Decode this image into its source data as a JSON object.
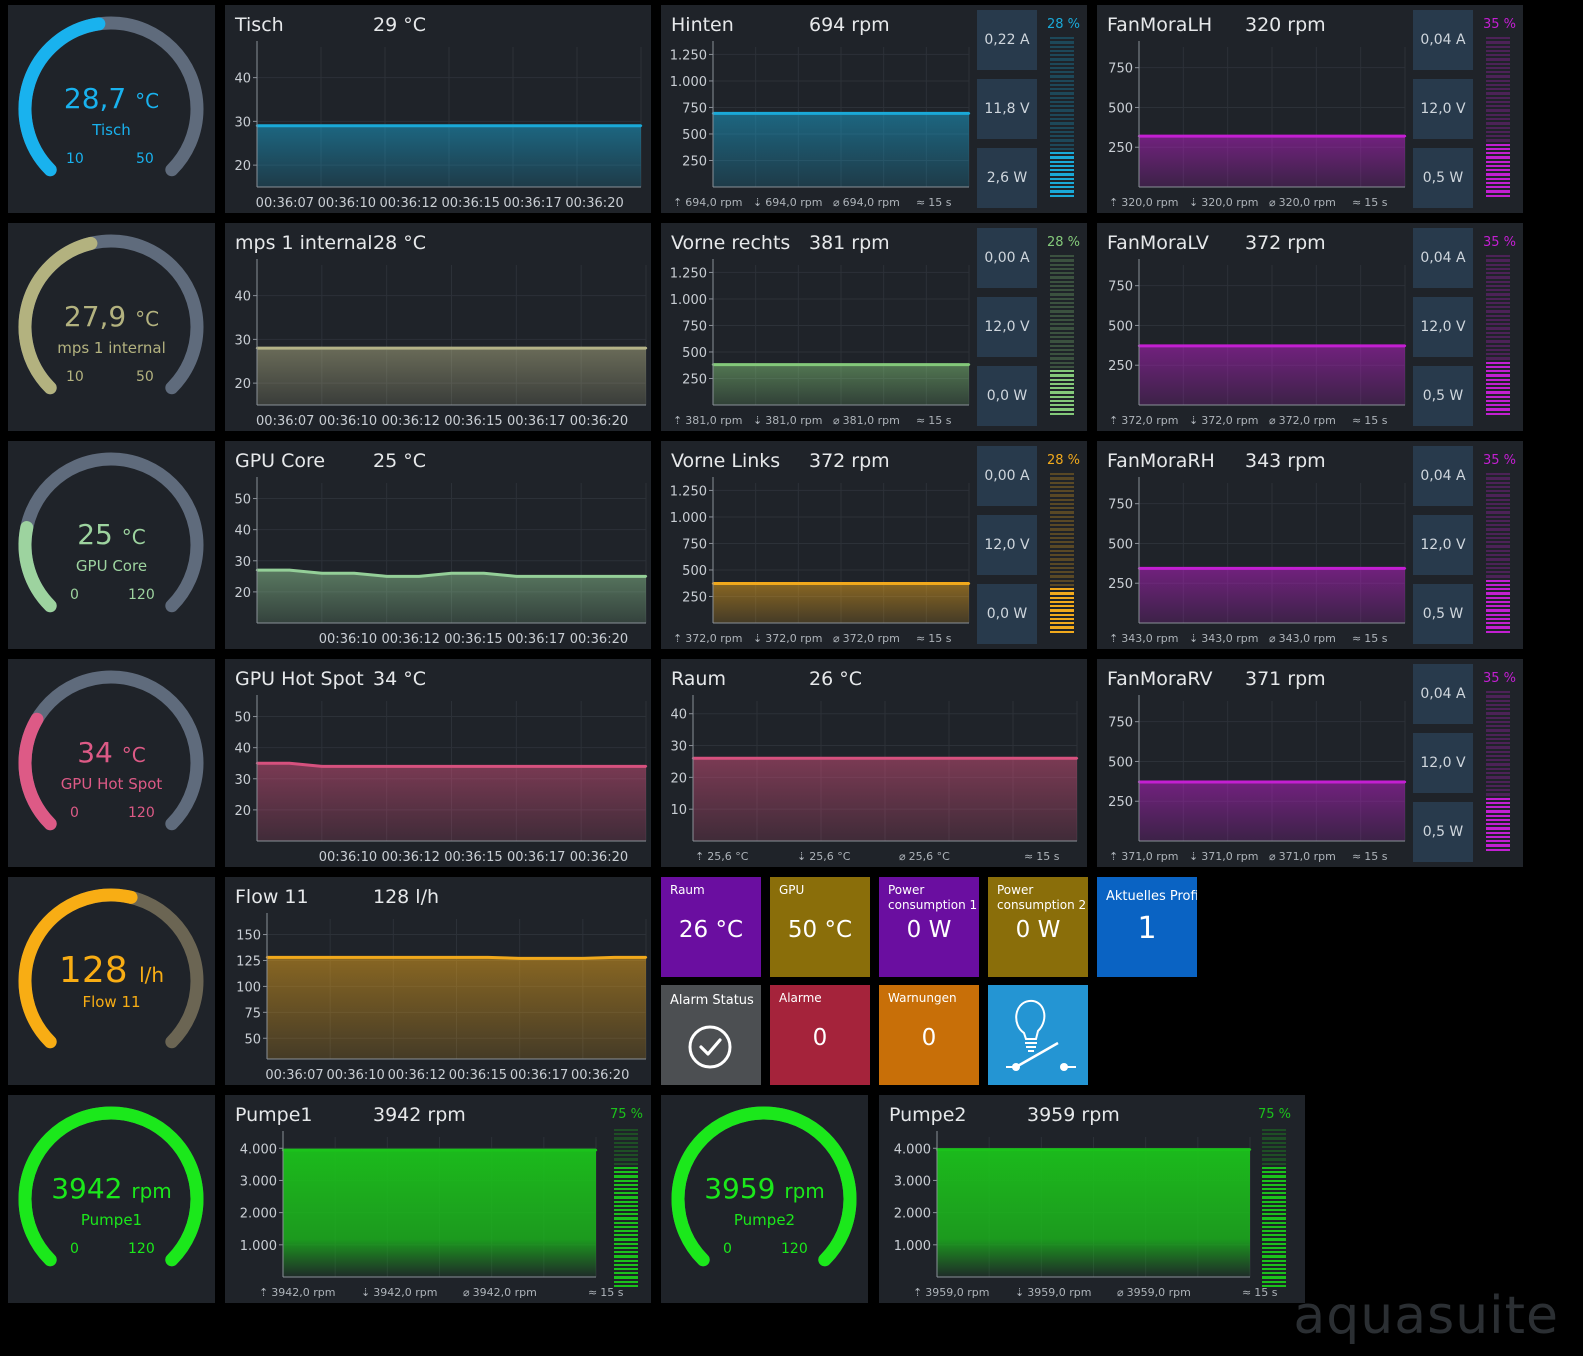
{
  "brand": "aquasuite",
  "gauges": [
    {
      "id": "g1",
      "value": "28,7",
      "unit": "°C",
      "name": "Tisch",
      "min": "10",
      "max": "50",
      "color": "#19b2ee",
      "fraction": 0.47
    },
    {
      "id": "g2",
      "value": "27,9",
      "unit": "°C",
      "name": "mps 1 internal",
      "min": "10",
      "max": "50",
      "color": "#b3b27f",
      "fraction": 0.45
    },
    {
      "id": "g3",
      "value": "25",
      "unit": "°C",
      "name": "GPU Core",
      "min": "0",
      "max": "120",
      "color": "#9dd39f",
      "fraction": 0.21
    },
    {
      "id": "g4",
      "value": "34",
      "unit": "°C",
      "name": "GPU Hot Spot",
      "min": "0",
      "max": "120",
      "color": "#dd5a86",
      "fraction": 0.28
    },
    {
      "id": "g5",
      "value": "128",
      "unit": "l/h",
      "name": "Flow 11",
      "min": "",
      "max": "",
      "color": "#f8ad14",
      "fraction": 0.55
    },
    {
      "id": "g6",
      "value": "3942",
      "unit": "rpm",
      "name": "Pumpe1",
      "min": "0",
      "max": "120",
      "color": "#1be81b",
      "fraction": 1.0
    },
    {
      "id": "g7",
      "value": "3959",
      "unit": "rpm",
      "name": "Pumpe2",
      "min": "0",
      "max": "120",
      "color": "#1be81b",
      "fraction": 1.0
    }
  ],
  "charts": [
    {
      "id": "c1",
      "type": "line",
      "title": "Tisch",
      "value": "29 °C",
      "color": "#1aa9d8",
      "yticks": [
        {
          "v": 20,
          "l": "20"
        },
        {
          "v": 30,
          "l": "30"
        },
        {
          "v": 40,
          "l": "40"
        }
      ],
      "ylim": [
        15,
        47
      ],
      "xticks": [
        "00:36:07",
        "00:36:10",
        "00:36:12",
        "00:36:15",
        "00:36:17",
        "00:36:20"
      ],
      "values": [
        29,
        29,
        29,
        29,
        29,
        29,
        29,
        29,
        29,
        29,
        29,
        29,
        29
      ],
      "footer": []
    },
    {
      "id": "c2",
      "type": "line",
      "title": "mps 1 internal",
      "value": "28 °C",
      "color": "#b4b387",
      "yticks": [
        {
          "v": 20,
          "l": "20"
        },
        {
          "v": 30,
          "l": "30"
        },
        {
          "v": 40,
          "l": "40"
        }
      ],
      "ylim": [
        15,
        47
      ],
      "xticks": [
        "00:36:07",
        "00:36:10",
        "00:36:12",
        "00:36:15",
        "00:36:17",
        "00:36:20"
      ],
      "values": [
        28,
        28,
        28,
        28,
        28,
        28,
        28,
        28,
        28,
        28,
        28,
        28,
        28
      ],
      "footer": []
    },
    {
      "id": "c3",
      "type": "line",
      "title": "GPU Core",
      "value": "25 °C",
      "color": "#94cf98",
      "yticks": [
        {
          "v": 20,
          "l": "20"
        },
        {
          "v": 30,
          "l": "30"
        },
        {
          "v": 40,
          "l": "40"
        },
        {
          "v": 50,
          "l": "50"
        }
      ],
      "ylim": [
        10,
        55
      ],
      "xticks": [
        "00:36:10",
        "00:36:12",
        "00:36:15",
        "00:36:17",
        "00:36:20"
      ],
      "values": [
        27,
        27,
        26,
        26,
        25,
        25,
        26,
        26,
        25,
        25,
        25,
        25,
        25
      ],
      "footer": []
    },
    {
      "id": "c4",
      "type": "line",
      "title": "GPU Hot Spot",
      "value": "34 °C",
      "color": "#d6517e",
      "yticks": [
        {
          "v": 20,
          "l": "20"
        },
        {
          "v": 30,
          "l": "30"
        },
        {
          "v": 40,
          "l": "40"
        },
        {
          "v": 50,
          "l": "50"
        }
      ],
      "ylim": [
        10,
        55
      ],
      "xticks": [
        "00:36:10",
        "00:36:12",
        "00:36:15",
        "00:36:17",
        "00:36:20"
      ],
      "values": [
        35,
        35,
        34,
        34,
        34,
        34,
        34,
        34,
        34,
        34,
        34,
        34,
        34
      ],
      "footer": []
    },
    {
      "id": "c5",
      "type": "line",
      "title": "Flow 11",
      "value": "128 l/h",
      "color": "#f1a91c",
      "yticks": [
        {
          "v": 50,
          "l": "50"
        },
        {
          "v": 75,
          "l": "75"
        },
        {
          "v": 100,
          "l": "100"
        },
        {
          "v": 125,
          "l": "125"
        },
        {
          "v": 150,
          "l": "150"
        }
      ],
      "ylim": [
        30,
        165
      ],
      "xticks": [
        "00:36:07",
        "00:36:10",
        "00:36:12",
        "00:36:15",
        "00:36:17",
        "00:36:20"
      ],
      "values": [
        128,
        128,
        128,
        128,
        128,
        128,
        128,
        128,
        127,
        127,
        127,
        128,
        128
      ],
      "footer": []
    },
    {
      "id": "c6",
      "type": "line",
      "title": "Hinten",
      "value": "694 rpm",
      "color": "#1aa9d8",
      "yticks": [
        {
          "v": 250,
          "l": "250"
        },
        {
          "v": 500,
          "l": "500"
        },
        {
          "v": 750,
          "l": "750"
        },
        {
          "v": 1000,
          "l": "1.000"
        },
        {
          "v": 1250,
          "l": "1.250"
        }
      ],
      "ylim": [
        0,
        1320
      ],
      "xticks": [],
      "values": [
        694,
        694,
        694,
        694,
        694,
        694,
        694,
        694,
        694,
        694,
        694,
        694,
        694
      ],
      "footer": [
        "694,0 rpm",
        "694,0 rpm",
        "694,0 rpm",
        "15 s"
      ],
      "stats": [
        "0,22 A",
        "11,8 V",
        "2,6 W"
      ],
      "percent": "28 %",
      "level": 0.28
    },
    {
      "id": "c7",
      "type": "line",
      "title": "Vorne rechts",
      "value": "381 rpm",
      "color": "#84c97a",
      "yticks": [
        {
          "v": 250,
          "l": "250"
        },
        {
          "v": 500,
          "l": "500"
        },
        {
          "v": 750,
          "l": "750"
        },
        {
          "v": 1000,
          "l": "1.000"
        },
        {
          "v": 1250,
          "l": "1.250"
        }
      ],
      "ylim": [
        0,
        1320
      ],
      "xticks": [],
      "values": [
        381,
        381,
        381,
        381,
        381,
        381,
        381,
        381,
        381,
        381,
        381,
        381,
        381
      ],
      "footer": [
        "381,0 rpm",
        "381,0 rpm",
        "381,0 rpm",
        "15 s"
      ],
      "stats": [
        "0,00 A",
        "12,0 V",
        "0,0 W"
      ],
      "percent": "28 %",
      "level": 0.28
    },
    {
      "id": "c8",
      "type": "line",
      "title": "Vorne Links",
      "value": "372 rpm",
      "color": "#f1a91c",
      "yticks": [
        {
          "v": 250,
          "l": "250"
        },
        {
          "v": 500,
          "l": "500"
        },
        {
          "v": 750,
          "l": "750"
        },
        {
          "v": 1000,
          "l": "1.000"
        },
        {
          "v": 1250,
          "l": "1.250"
        }
      ],
      "ylim": [
        0,
        1320
      ],
      "xticks": [],
      "values": [
        372,
        372,
        372,
        372,
        372,
        372,
        372,
        372,
        372,
        372,
        372,
        372,
        372
      ],
      "footer": [
        "372,0 rpm",
        "372,0 rpm",
        "372,0 rpm",
        "15 s"
      ],
      "stats": [
        "0,00 A",
        "12,0 V",
        "0,0 W"
      ],
      "percent": "28 %",
      "level": 0.28
    },
    {
      "id": "c9",
      "type": "line",
      "title": "Raum",
      "value": "26 °C",
      "color": "#d6517e",
      "yticks": [
        {
          "v": 10,
          "l": "10"
        },
        {
          "v": 20,
          "l": "20"
        },
        {
          "v": 30,
          "l": "30"
        },
        {
          "v": 40,
          "l": "40"
        }
      ],
      "ylim": [
        0,
        44
      ],
      "xticks": [],
      "values": [
        26,
        26,
        26,
        26,
        26,
        26,
        26,
        26,
        26,
        26,
        26,
        26,
        26
      ],
      "footer": [
        "25,6 °C",
        "25,6 °C",
        "25,6 °C",
        "15 s"
      ]
    },
    {
      "id": "c10",
      "type": "line",
      "title": "FanMoraLH",
      "value": "320 rpm",
      "color": "#c31fd2",
      "yticks": [
        {
          "v": 250,
          "l": "250"
        },
        {
          "v": 500,
          "l": "500"
        },
        {
          "v": 750,
          "l": "750"
        }
      ],
      "ylim": [
        0,
        880
      ],
      "xticks": [],
      "values": [
        320,
        320,
        320,
        320,
        320,
        320,
        320,
        320,
        320,
        320,
        320,
        320,
        320
      ],
      "footer": [
        "320,0 rpm",
        "320,0 rpm",
        "320,0 rpm",
        "15 s"
      ],
      "stats": [
        "0,04 A",
        "12,0 V",
        "0,5 W"
      ],
      "percent": "35 %",
      "level": 0.35
    },
    {
      "id": "c11",
      "type": "line",
      "title": "FanMoraLV",
      "value": "372 rpm",
      "color": "#c31fd2",
      "yticks": [
        {
          "v": 250,
          "l": "250"
        },
        {
          "v": 500,
          "l": "500"
        },
        {
          "v": 750,
          "l": "750"
        }
      ],
      "ylim": [
        0,
        880
      ],
      "xticks": [],
      "values": [
        372,
        372,
        372,
        372,
        372,
        372,
        372,
        372,
        372,
        372,
        372,
        372,
        372
      ],
      "footer": [
        "372,0 rpm",
        "372,0 rpm",
        "372,0 rpm",
        "15 s"
      ],
      "stats": [
        "0,04 A",
        "12,0 V",
        "0,5 W"
      ],
      "percent": "35 %",
      "level": 0.35
    },
    {
      "id": "c12",
      "type": "line",
      "title": "FanMoraRH",
      "value": "343 rpm",
      "color": "#c31fd2",
      "yticks": [
        {
          "v": 250,
          "l": "250"
        },
        {
          "v": 500,
          "l": "500"
        },
        {
          "v": 750,
          "l": "750"
        }
      ],
      "ylim": [
        0,
        880
      ],
      "xticks": [],
      "values": [
        343,
        343,
        343,
        343,
        343,
        343,
        343,
        343,
        343,
        343,
        343,
        343,
        343
      ],
      "footer": [
        "343,0 rpm",
        "343,0 rpm",
        "343,0 rpm",
        "15 s"
      ],
      "stats": [
        "0,04 A",
        "12,0 V",
        "0,5 W"
      ],
      "percent": "35 %",
      "level": 0.35
    },
    {
      "id": "c13",
      "type": "line",
      "title": "FanMoraRV",
      "value": "371 rpm",
      "color": "#c31fd2",
      "yticks": [
        {
          "v": 250,
          "l": "250"
        },
        {
          "v": 500,
          "l": "500"
        },
        {
          "v": 750,
          "l": "750"
        }
      ],
      "ylim": [
        0,
        880
      ],
      "xticks": [],
      "values": [
        371,
        371,
        371,
        371,
        371,
        371,
        371,
        371,
        371,
        371,
        371,
        371,
        371
      ],
      "footer": [
        "371,0 rpm",
        "371,0 rpm",
        "371,0 rpm",
        "15 s"
      ],
      "stats": [
        "0,04 A",
        "12,0 V",
        "0,5 W"
      ],
      "percent": "35 %",
      "level": 0.35
    },
    {
      "id": "c14",
      "type": "area",
      "title": "Pumpe1",
      "value": "3942 rpm",
      "color": "#1bc21b",
      "yticks": [
        {
          "v": 1000,
          "l": "1.000"
        },
        {
          "v": 2000,
          "l": "2.000"
        },
        {
          "v": 3000,
          "l": "3.000"
        },
        {
          "v": 4000,
          "l": "4.000"
        }
      ],
      "ylim": [
        0,
        4350
      ],
      "xticks": [],
      "values": [
        3942,
        3942,
        3942,
        3942,
        3942,
        3942,
        3942,
        3942,
        3942,
        3942,
        3942,
        3942,
        3942
      ],
      "footer": [
        "3942,0 rpm",
        "3942,0 rpm",
        "3942,0 rpm",
        "15 s"
      ],
      "percent": "75 %",
      "level": 0.75
    },
    {
      "id": "c15",
      "type": "area",
      "title": "Pumpe2",
      "value": "3959 rpm",
      "color": "#1bc21b",
      "yticks": [
        {
          "v": 1000,
          "l": "1.000"
        },
        {
          "v": 2000,
          "l": "2.000"
        },
        {
          "v": 3000,
          "l": "3.000"
        },
        {
          "v": 4000,
          "l": "4.000"
        }
      ],
      "ylim": [
        0,
        4350
      ],
      "xticks": [],
      "values": [
        3959,
        3959,
        3959,
        3959,
        3959,
        3959,
        3959,
        3959,
        3959,
        3959,
        3959,
        3959,
        3959
      ],
      "footer": [
        "3959,0 rpm",
        "3959,0 rpm",
        "3959,0 rpm",
        "15 s"
      ],
      "percent": "75 %",
      "level": 0.75
    }
  ],
  "tiles": [
    {
      "id": "t1",
      "label": "Raum",
      "value": "26 °C",
      "bg": "#6a0ea0"
    },
    {
      "id": "t2",
      "label": "GPU",
      "value": "50 °C",
      "bg": "#8a6e0a"
    },
    {
      "id": "t3",
      "label": "Power consumption 1",
      "value": "0 W",
      "bg": "#6a0ea0"
    },
    {
      "id": "t4",
      "label": "Power consumption 2",
      "value": "0 W",
      "bg": "#8a6e0a"
    },
    {
      "id": "t5",
      "label": "Aktuelles Profil",
      "value": "1",
      "bg": "#0a63c3"
    },
    {
      "id": "t6",
      "label": "Alarm Status",
      "value": "",
      "bg": "#4c4f52",
      "icon": "check-circle-icon"
    },
    {
      "id": "t7",
      "label": "Alarme",
      "value": "0",
      "bg": "#a5233b"
    },
    {
      "id": "t8",
      "label": "Warnungen",
      "value": "0",
      "bg": "#c86f08"
    },
    {
      "id": "t9",
      "label": "",
      "value": "",
      "bg": "#2495d3",
      "icon": "lightbulb-switch-icon"
    }
  ]
}
